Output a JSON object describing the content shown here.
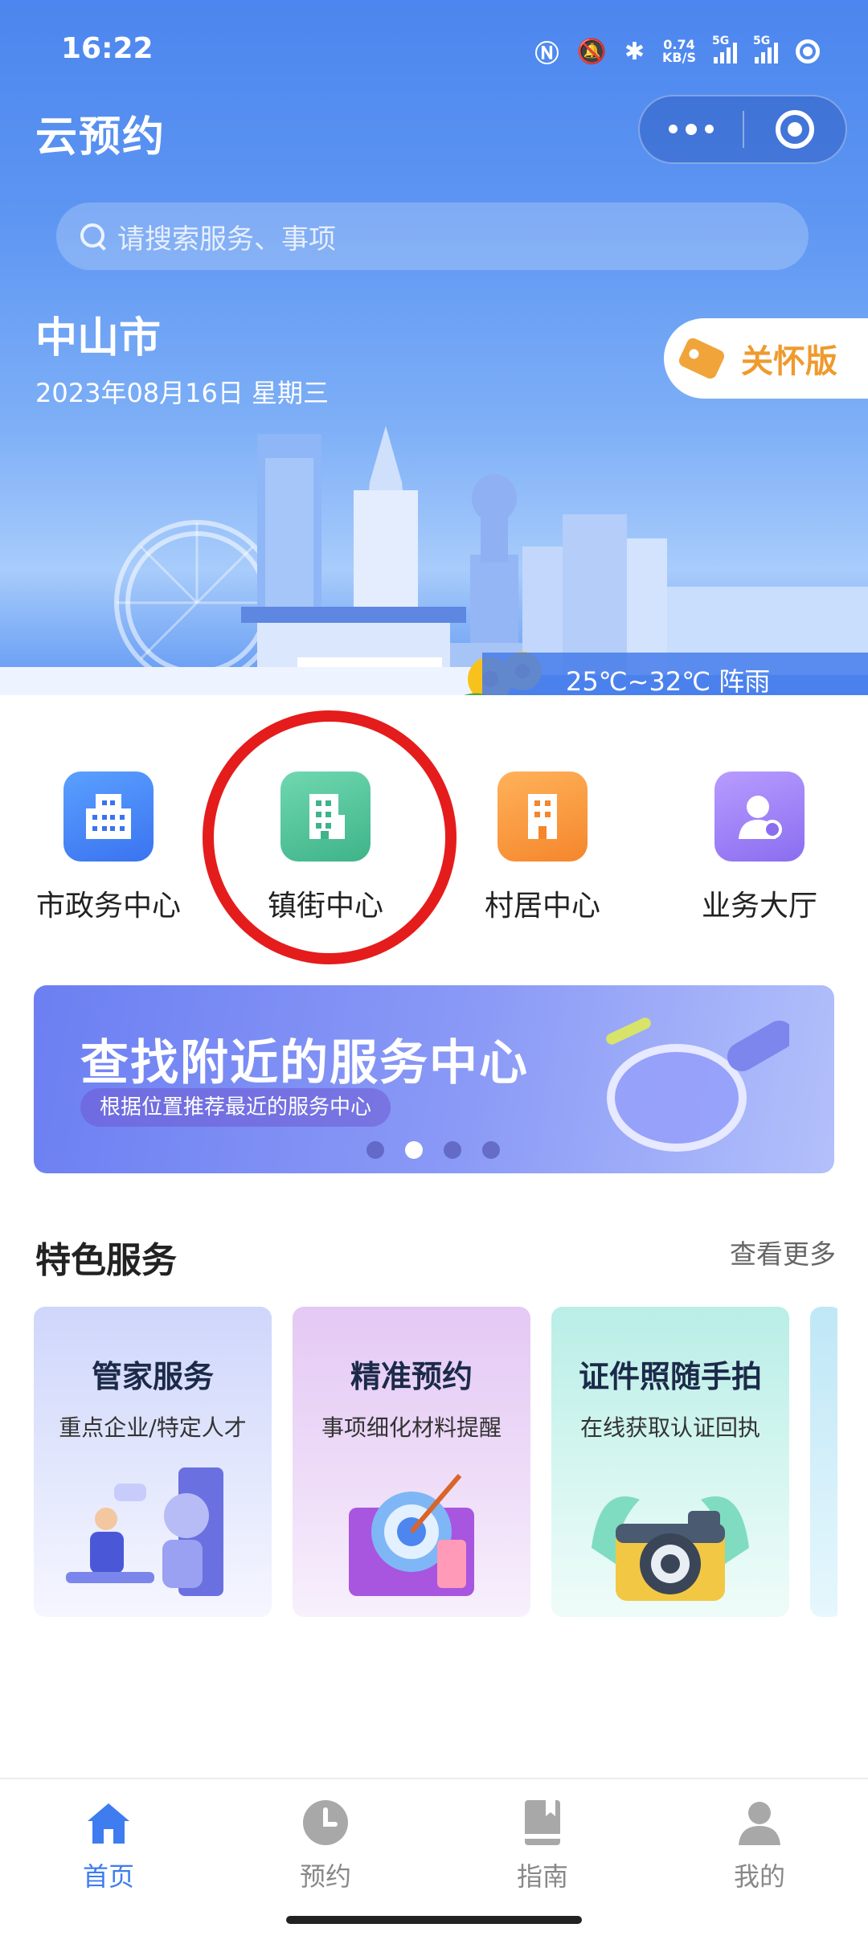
{
  "status_bar": {
    "time": "16:22",
    "network_speed_value": "0.74",
    "network_speed_unit": "KB/S",
    "sim1_label": "5G",
    "sim2_label": "5G"
  },
  "app": {
    "title": "云预约"
  },
  "search": {
    "placeholder": "请搜索服务、事项"
  },
  "location": {
    "city": "中山市",
    "date": "2023年08月16日 星期三"
  },
  "care_mode": {
    "label": "关怀版"
  },
  "weather": {
    "text": "25℃~32℃ 阵雨"
  },
  "quick_entries": [
    {
      "label": "市政务中心",
      "icon": "city-building-icon",
      "color": "#3a73f0"
    },
    {
      "label": "镇街中心",
      "icon": "town-building-icon",
      "color": "#3fb389"
    },
    {
      "label": "村居中心",
      "icon": "village-building-icon",
      "color": "#f5862c"
    },
    {
      "label": "业务大厅",
      "icon": "service-hall-user-icon",
      "color": "#8a6df0"
    }
  ],
  "banner": {
    "title": "查找附近的服务中心",
    "subtitle": "根据位置推荐最近的服务中心",
    "slide_count": 4,
    "active_slide": 2
  },
  "featured": {
    "title": "特色服务",
    "more_label": "查看更多",
    "cards": [
      {
        "title": "管家服务",
        "subtitle": "重点企业/特定人才"
      },
      {
        "title": "精准预约",
        "subtitle": "事项细化材料提醒"
      },
      {
        "title": "证件照随手拍",
        "subtitle": "在线获取认证回执"
      }
    ]
  },
  "tabbar": {
    "items": [
      {
        "label": "首页",
        "icon": "home-icon",
        "active": true
      },
      {
        "label": "预约",
        "icon": "clock-icon",
        "active": false
      },
      {
        "label": "指南",
        "icon": "book-icon",
        "active": false
      },
      {
        "label": "我的",
        "icon": "user-icon",
        "active": false
      }
    ]
  },
  "colors": {
    "primary": "#3e7cf0",
    "annotation_circle": "#e51c1c",
    "care_accent": "#ef9a2d"
  }
}
